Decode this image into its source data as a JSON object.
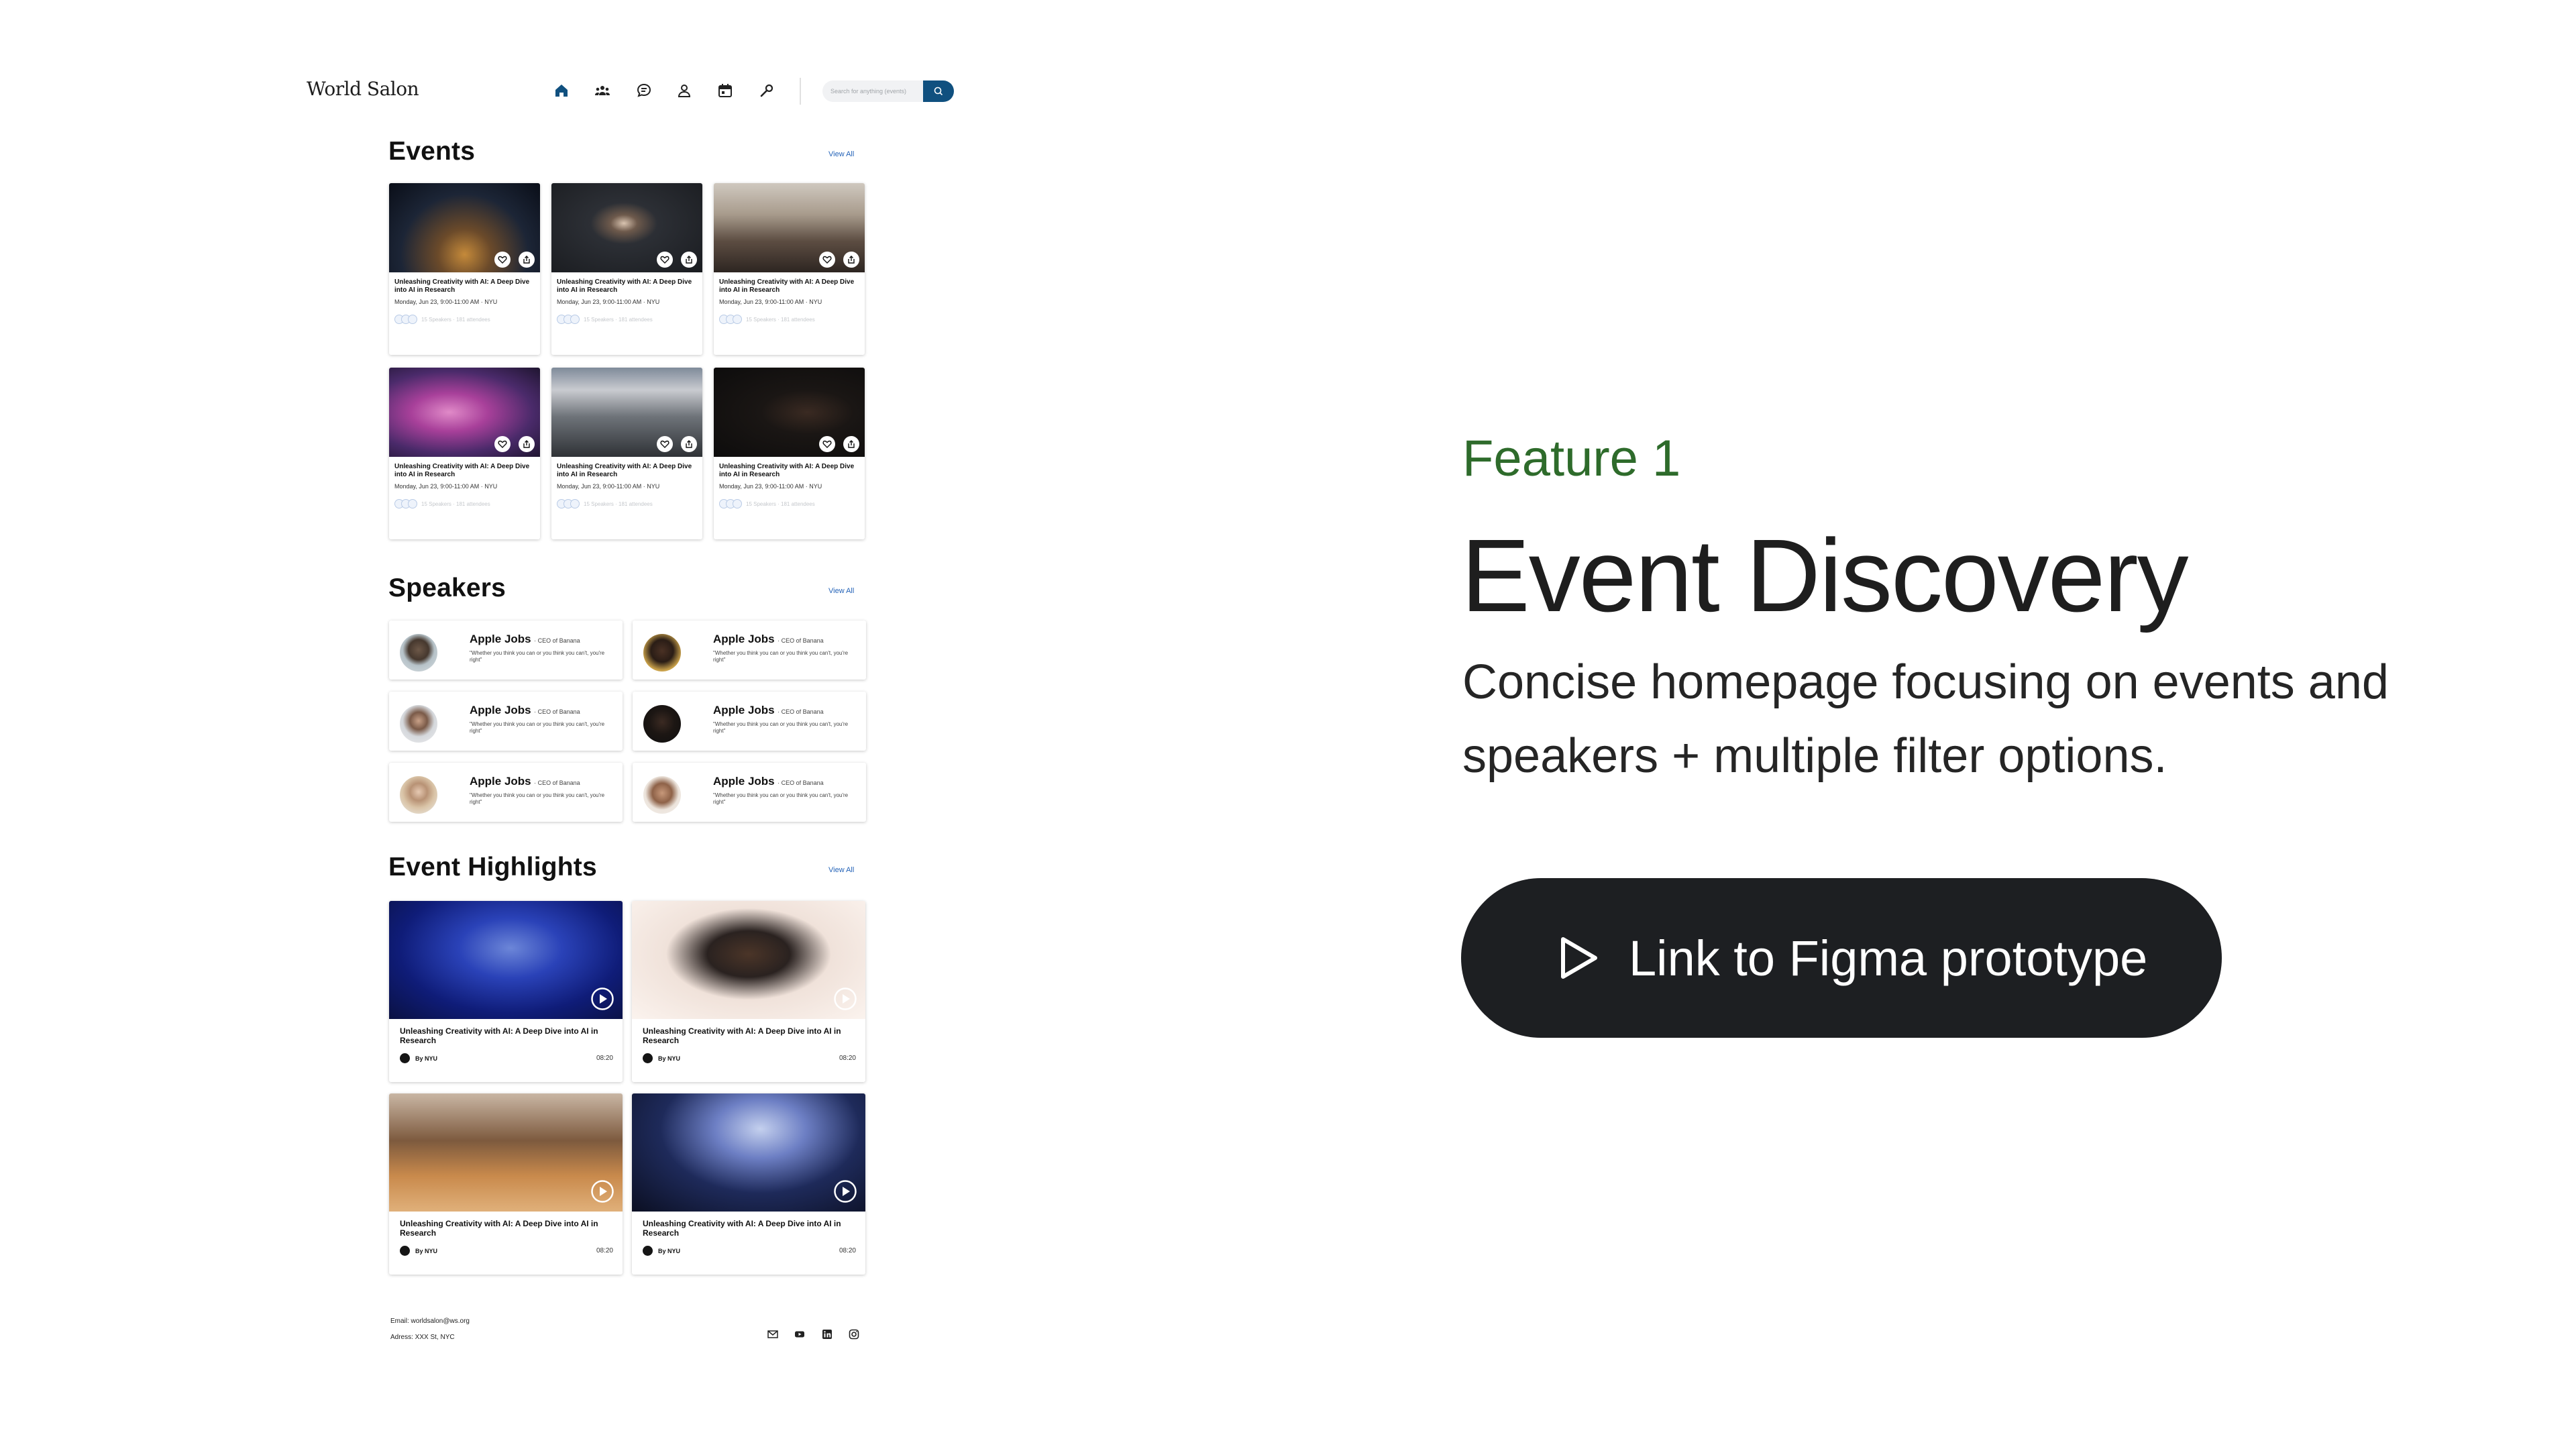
{
  "brand": "World Salon",
  "search": {
    "placeholder": "Search for anything (events)"
  },
  "nav_icons": [
    "home-icon",
    "community-icon",
    "chat-icon",
    "profile-icon",
    "calendar-icon",
    "tools-icon"
  ],
  "colors": {
    "nav_active": "#10507f",
    "search_button": "#10507f",
    "feature_kicker": "#2e6b2b",
    "figma_button": "#1d1f22"
  },
  "events": {
    "title": "Events",
    "view_all": "View All",
    "cards": [
      {
        "title": "Unleashing Creativity with AI: A Deep Dive into AI in Research",
        "date": "Monday, Jun 23, 9:00-11:00 AM · NYU",
        "stats": "15 Speakers · 181 attendees"
      },
      {
        "title": "Unleashing Creativity with AI: A Deep Dive into AI in Research",
        "date": "Monday, Jun 23, 9:00-11:00 AM · NYU",
        "stats": "15 Speakers · 181 attendees"
      },
      {
        "title": "Unleashing Creativity with AI: A Deep Dive into AI in Research",
        "date": "Monday, Jun 23, 9:00-11:00 AM · NYU",
        "stats": "15 Speakers · 181 attendees"
      },
      {
        "title": "Unleashing Creativity with AI: A Deep Dive into AI in Research",
        "date": "Monday, Jun 23, 9:00-11:00 AM · NYU",
        "stats": "15 Speakers · 181 attendees"
      },
      {
        "title": "Unleashing Creativity with AI: A Deep Dive into AI in Research",
        "date": "Monday, Jun 23, 9:00-11:00 AM · NYU",
        "stats": "15 Speakers · 181 attendees"
      },
      {
        "title": "Unleashing Creativity with AI: A Deep Dive into AI in Research",
        "date": "Monday, Jun 23, 9:00-11:00 AM · NYU",
        "stats": "15 Speakers · 181 attendees"
      }
    ]
  },
  "speakers": {
    "title": "Speakers",
    "view_all": "View All",
    "cards": [
      {
        "name": "Apple Jobs",
        "role": "· CEO of Banana",
        "quote": "\"Whether you think you can or you think you can't, you're right\""
      },
      {
        "name": "Apple Jobs",
        "role": "· CEO of Banana",
        "quote": "\"Whether you think you can or you think you can't, you're right\""
      },
      {
        "name": "Apple Jobs",
        "role": "· CEO of Banana",
        "quote": "\"Whether you think you can or you think you can't, you're right\""
      },
      {
        "name": "Apple Jobs",
        "role": "· CEO of Banana",
        "quote": "\"Whether you think you can or you think you can't, you're right\""
      },
      {
        "name": "Apple Jobs",
        "role": "· CEO of Banana",
        "quote": "\"Whether you think you can or you think you can't, you're right\""
      },
      {
        "name": "Apple Jobs",
        "role": "· CEO of Banana",
        "quote": "\"Whether you think you can or you think you can't, you're right\""
      }
    ]
  },
  "highlights": {
    "title": "Event Highlights",
    "view_all": "View All",
    "cards": [
      {
        "title": "Unleashing Creativity with AI: A Deep Dive into AI in Research",
        "by": "By NYU",
        "duration": "08:20"
      },
      {
        "title": "Unleashing Creativity with AI: A Deep Dive into AI in Research",
        "by": "By NYU",
        "duration": "08:20"
      },
      {
        "title": "Unleashing Creativity with AI: A Deep Dive into AI in Research",
        "by": "By NYU",
        "duration": "08:20"
      },
      {
        "title": "Unleashing Creativity with AI: A Deep Dive into AI in Research",
        "by": "By NYU",
        "duration": "08:20"
      }
    ]
  },
  "footer": {
    "email": "Email: worldsalon@ws.org",
    "address": "Adress: XXX St, NYC",
    "social_icons": [
      "mail-icon",
      "youtube-icon",
      "linkedin-icon",
      "instagram-icon"
    ]
  },
  "feature": {
    "kicker": "Feature 1",
    "title": "Event Discovery",
    "description": "Concise homepage focusing on events and speakers + multiple filter options.",
    "cta": "Link to Figma prototype"
  }
}
